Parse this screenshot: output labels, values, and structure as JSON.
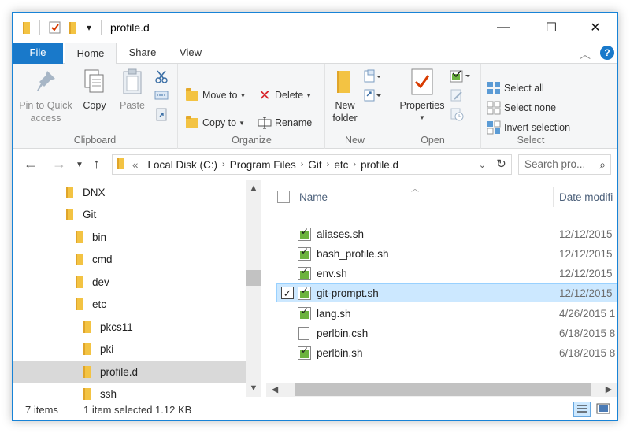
{
  "window": {
    "title": "profile.d"
  },
  "titlebar": {
    "minimize_glyph": "—",
    "maximize_glyph": "☐",
    "close_glyph": "✕",
    "qa_dropdown_glyph": "▾"
  },
  "ribbon_tabs": [
    {
      "label": "File"
    },
    {
      "label": "Home"
    },
    {
      "label": "Share"
    },
    {
      "label": "View"
    }
  ],
  "ribbon": {
    "clipboard": {
      "group_label": "Clipboard",
      "pin_label": "Pin to Quick access",
      "copy_label": "Copy",
      "paste_label": "Paste"
    },
    "organize": {
      "group_label": "Organize",
      "move_to_label": "Move to",
      "copy_to_label": "Copy to",
      "delete_label": "Delete",
      "rename_label": "Rename"
    },
    "new": {
      "group_label": "New",
      "new_folder_label": "New folder"
    },
    "open": {
      "group_label": "Open",
      "properties_label": "Properties"
    },
    "select": {
      "group_label": "Select",
      "select_all_label": "Select all",
      "select_none_label": "Select none",
      "invert_selection_label": "Invert selection"
    }
  },
  "address": {
    "overflow": "«",
    "crumbs": [
      "Local Disk (C:)",
      "Program Files",
      "Git",
      "etc",
      "profile.d"
    ],
    "search_placeholder": "Search pro..."
  },
  "nav_tree": [
    {
      "label": "DNX",
      "indent": 0
    },
    {
      "label": "Git",
      "indent": 0
    },
    {
      "label": "bin",
      "indent": 1
    },
    {
      "label": "cmd",
      "indent": 1
    },
    {
      "label": "dev",
      "indent": 1
    },
    {
      "label": "etc",
      "indent": 1
    },
    {
      "label": "pkcs11",
      "indent": 2
    },
    {
      "label": "pki",
      "indent": 2
    },
    {
      "label": "profile.d",
      "indent": 2,
      "selected": true
    },
    {
      "label": "ssh",
      "indent": 2
    }
  ],
  "file_list": {
    "columns": {
      "name": "Name",
      "date": "Date modifi"
    },
    "files": [
      {
        "name": "aliases.sh",
        "date": "12/12/2015",
        "icon": "shell-script-icon"
      },
      {
        "name": "bash_profile.sh",
        "date": "12/12/2015",
        "icon": "shell-script-icon"
      },
      {
        "name": "env.sh",
        "date": "12/12/2015",
        "icon": "shell-script-icon"
      },
      {
        "name": "git-prompt.sh",
        "date": "12/12/2015",
        "icon": "shell-script-icon",
        "selected": true
      },
      {
        "name": "lang.sh",
        "date": "4/26/2015 1",
        "icon": "shell-script-icon"
      },
      {
        "name": "perlbin.csh",
        "date": "6/18/2015 8",
        "icon": "document-icon"
      },
      {
        "name": "perlbin.sh",
        "date": "6/18/2015 8",
        "icon": "shell-script-icon"
      }
    ]
  },
  "status": {
    "item_count": "7 items",
    "selection": "1 item selected  1.12 KB"
  },
  "colors": {
    "accent": "#1979ca",
    "selection_bg": "#cce8ff",
    "folder": "#f3c343"
  }
}
